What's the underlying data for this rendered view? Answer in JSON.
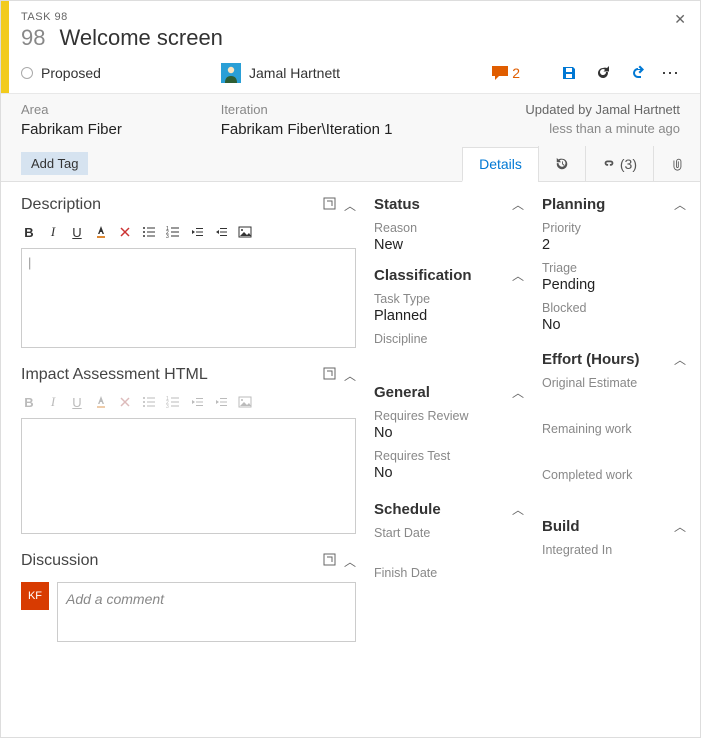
{
  "header": {
    "task_label": "TASK 98",
    "id": "98",
    "title": "Welcome screen",
    "state": "Proposed",
    "assignee": "Jamal Hartnett",
    "comment_count": "2"
  },
  "info": {
    "area_label": "Area",
    "area_value": "Fabrikam Fiber",
    "iteration_label": "Iteration",
    "iteration_value": "Fabrikam Fiber\\Iteration 1",
    "updated_by": "Updated by Jamal Hartnett",
    "updated_time": "less than a minute ago"
  },
  "tags": {
    "add_tag": "Add Tag"
  },
  "tabs": {
    "details": "Details",
    "links_count": "(3)"
  },
  "sections": {
    "description": "Description",
    "impact": "Impact Assessment HTML",
    "discussion": "Discussion",
    "comment_placeholder": "Add a comment",
    "disc_avatar": "KF"
  },
  "mid": {
    "status_title": "Status",
    "reason_label": "Reason",
    "reason_value": "New",
    "classification_title": "Classification",
    "tasktype_label": "Task Type",
    "tasktype_value": "Planned",
    "discipline_label": "Discipline",
    "general_title": "General",
    "reqreview_label": "Requires Review",
    "reqreview_value": "No",
    "reqtest_label": "Requires Test",
    "reqtest_value": "No",
    "schedule_title": "Schedule",
    "startdate_label": "Start Date",
    "finishdate_label": "Finish Date"
  },
  "right": {
    "planning_title": "Planning",
    "priority_label": "Priority",
    "priority_value": "2",
    "triage_label": "Triage",
    "triage_value": "Pending",
    "blocked_label": "Blocked",
    "blocked_value": "No",
    "effort_title": "Effort (Hours)",
    "origest_label": "Original Estimate",
    "remaining_label": "Remaining work",
    "completed_label": "Completed work",
    "build_title": "Build",
    "integrated_label": "Integrated In"
  }
}
